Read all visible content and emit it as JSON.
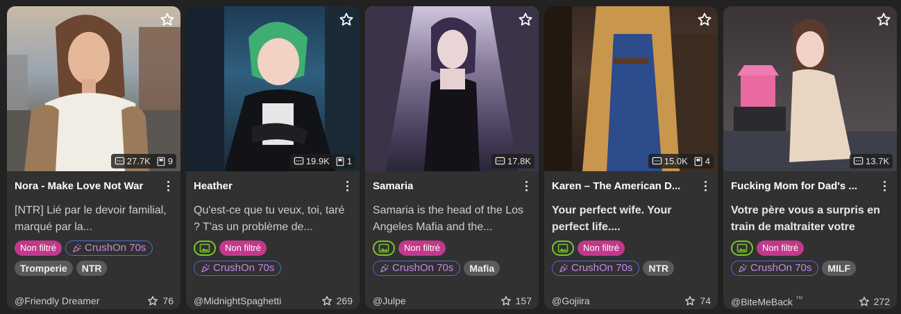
{
  "cards": [
    {
      "title": "Nora - Make Love Not War",
      "messages": "27.7K",
      "chats": "9",
      "description": "[NTR] Lié par le devoir familial, marqué par la...",
      "description_bold": false,
      "tags_row1": [
        "Non filtré",
        "CrushOn 70s"
      ],
      "tags_row2": [
        "Tromperie",
        "NTR"
      ],
      "author": "@Friendly Dreamer",
      "likes": "76"
    },
    {
      "title": "Heather",
      "messages": "19.9K",
      "chats": "1",
      "description": "Qu'est-ce que tu veux, toi, taré ? T'as un problème de...",
      "description_bold": false,
      "tags": [
        "Non filtré",
        "CrushOn 70s"
      ],
      "author": "@MidnightSpaghetti",
      "likes": "269"
    },
    {
      "title": "Samaria",
      "messages": "17.8K",
      "description": "Samaria is the head of the Los Angeles Mafia and the...",
      "description_bold": false,
      "tags": [
        "Non filtré",
        "CrushOn 70s",
        "Mafia"
      ],
      "author": "@Julpe",
      "likes": "157"
    },
    {
      "title": "Karen – The American D...",
      "messages": "15.0K",
      "chats": "4",
      "description": "Your perfect wife. Your perfect life....",
      "description_bold": true,
      "tags": [
        "Non filtré",
        "CrushOn 70s",
        "NTR"
      ],
      "author": "@Gojiira",
      "likes": "74"
    },
    {
      "title": "Fucking Mom for Dad's ...",
      "messages": "13.7K",
      "description": "Votre père vous a surpris en train de maltraiter votre",
      "description_bold": true,
      "tags": [
        "Non filtré",
        "CrushOn 70s",
        "MILF"
      ],
      "author": "@BiteMeBack",
      "author_badge": "™",
      "likes": "272"
    }
  ],
  "icons": {
    "favorite": "star-outline-icon",
    "messages": "chat-bubble-icon",
    "chats": "book-icon",
    "more": "more-vertical-icon",
    "image_tag": "image-icon",
    "crushon": "party-popper-icon",
    "likes": "star-outline-icon"
  },
  "colors": {
    "background": "#222222",
    "card": "#313131",
    "tag_pink": "#c2398b",
    "tag_grey": "#5a5a5a",
    "crushon_border": "#4d6dd6",
    "crushon_text": "#c48ae8",
    "image_tag_border": "#7bc42c"
  }
}
